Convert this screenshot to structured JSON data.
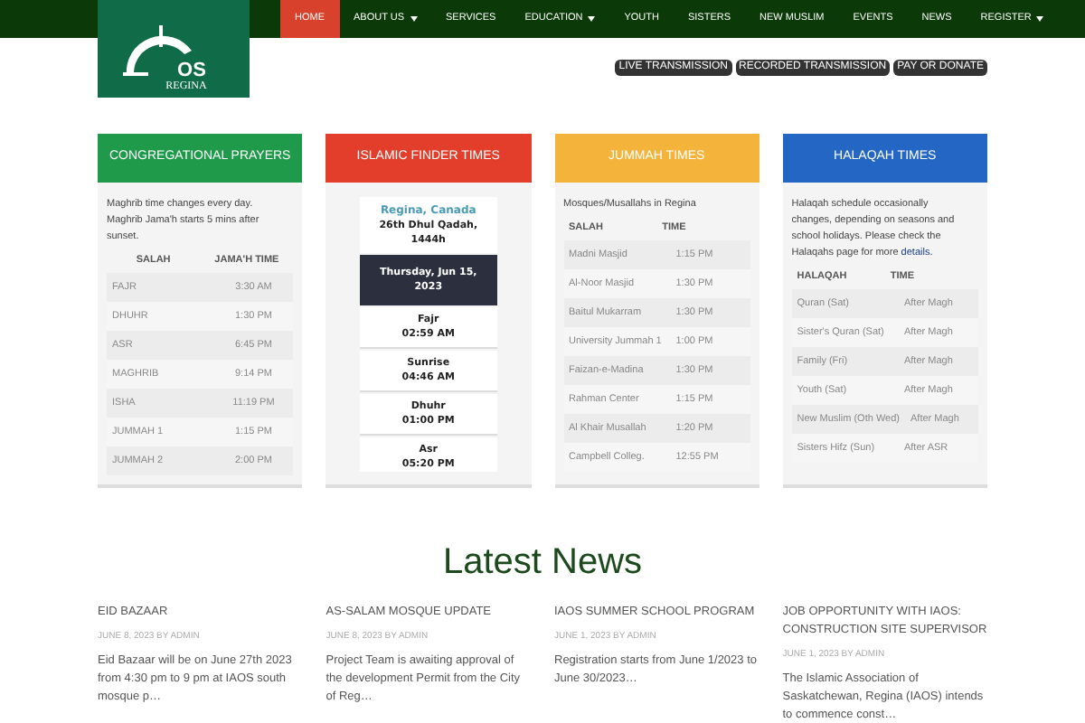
{
  "logo": {
    "mark": "OS",
    "city": "REGINA"
  },
  "nav": [
    {
      "label": "HOME",
      "selected": true,
      "dropdown": false
    },
    {
      "label": "ABOUT US",
      "selected": false,
      "dropdown": true
    },
    {
      "label": "SERVICES",
      "selected": false,
      "dropdown": false
    },
    {
      "label": "EDUCATION",
      "selected": false,
      "dropdown": true
    },
    {
      "label": "YOUTH",
      "selected": false,
      "dropdown": false
    },
    {
      "label": "SISTERS",
      "selected": false,
      "dropdown": false
    },
    {
      "label": "NEW MUSLIM",
      "selected": false,
      "dropdown": false
    },
    {
      "label": "EVENTS",
      "selected": false,
      "dropdown": false
    },
    {
      "label": "NEWS",
      "selected": false,
      "dropdown": false
    },
    {
      "label": "REGISTER",
      "selected": false,
      "dropdown": true
    }
  ],
  "quick_links": [
    "LIVE TRANSMISSION",
    "RECORDED TRANSMISSION",
    "PAY OR DONATE"
  ],
  "panels": [
    {
      "kind": "table",
      "title": "CONGREGATIONAL PRAYERS",
      "color": "#1f9a4a",
      "intro": "Maghrib time changes every day. Maghrib Jama'h starts 5 mins after sunset.",
      "columns": [
        "SALAH",
        "JAMA'H TIME"
      ],
      "center": true,
      "rows": [
        [
          "FAJR",
          "3:30 AM"
        ],
        [
          "DHUHR",
          "1:30 PM"
        ],
        [
          "ASR",
          "6:45 PM"
        ],
        [
          "MAGHRIB",
          "9:14 PM"
        ],
        [
          "ISHA",
          "11:19 PM"
        ],
        [
          "JUMMAH 1",
          "1:15 PM"
        ],
        [
          "JUMMAH 2",
          "2:00 PM"
        ]
      ]
    },
    {
      "kind": "finder",
      "title": "ISLAMIC FINDER TIMES",
      "color": "#e23e2b",
      "location": "Regina, Canada",
      "hijri": "26th Dhul Qadah, 1444h",
      "date": "Thursday, Jun 15, 2023",
      "times": [
        {
          "name": "Fajr",
          "time": "02:59 AM"
        },
        {
          "name": "Sunrise",
          "time": "04:46 AM"
        },
        {
          "name": "Dhuhr",
          "time": "01:00 PM"
        },
        {
          "name": "Asr",
          "time": "05:20 PM"
        }
      ]
    },
    {
      "kind": "table",
      "title": "JUMMAH TIMES",
      "color": "#f4b43c",
      "intro": "Mosques/Musallahs in Regina",
      "columns": [
        "SALAH",
        "TIME"
      ],
      "center": false,
      "rows": [
        [
          "Madni Masjid",
          "1:15 PM"
        ],
        [
          "Al-Noor Masjid",
          "1:30 PM"
        ],
        [
          "Baitul Mukarram",
          "1:30 PM"
        ],
        [
          "University Jummah 1",
          "1:00 PM"
        ],
        [
          "Faizan-e-Madina",
          "1:30 PM"
        ],
        [
          "Rahman Center",
          "1:15 PM"
        ],
        [
          "Al Khair Musallah",
          "1:20 PM"
        ],
        [
          "Campbell Colleg.",
          "12:55 PM"
        ]
      ]
    },
    {
      "kind": "table",
      "title": "HALAQAH TIMES",
      "color": "#2466c4",
      "intro": "Halaqah schedule occasionally changes, depending on seasons and school holidays. Please check the Halaqahs page for more",
      "intro_link": "details.",
      "columns": [
        "HALAQAH",
        "TIME"
      ],
      "center": false,
      "rows": [
        [
          "Quran (Sat)",
          "After Magh"
        ],
        [
          "Sister's Quran (Sat)",
          "After Magh"
        ],
        [
          "Family (Fri)",
          "After Magh"
        ],
        [
          "Youth (Sat)",
          "After Magh"
        ],
        [
          "New Muslim (Oth Wed)",
          "After Magh"
        ],
        [
          "Sisters Hifz (Sun)",
          "After ASR"
        ]
      ]
    }
  ],
  "news_heading": "Latest News",
  "news": [
    {
      "title": "EID BAZAAR",
      "meta": "JUNE 8, 2023 BY ADMIN",
      "excerpt": "Eid Bazaar will be on June 27th 2023 from 4:30 pm to 9 pm at IAOS south mosque p…"
    },
    {
      "title": "AS-SALAM MOSQUE UPDATE",
      "meta": "JUNE 8, 2023 BY ADMIN",
      "excerpt": "Project Team is awaiting approval of the development Permit from the City of Reg…"
    },
    {
      "title": "IAOS SUMMER SCHOOL PROGRAM",
      "meta": "JUNE 1, 2023 BY ADMIN",
      "excerpt": "Registration starts from June 1/2023 to June 30/2023…"
    },
    {
      "title": "JOB OPPORTUNITY WITH IAOS: CONSTRUCTION SITE SUPERVISOR",
      "meta": "JUNE 1, 2023 BY ADMIN",
      "excerpt": "The Islamic Association of Saskatchewan, Regina (IAOS) intends to commence const…"
    }
  ]
}
